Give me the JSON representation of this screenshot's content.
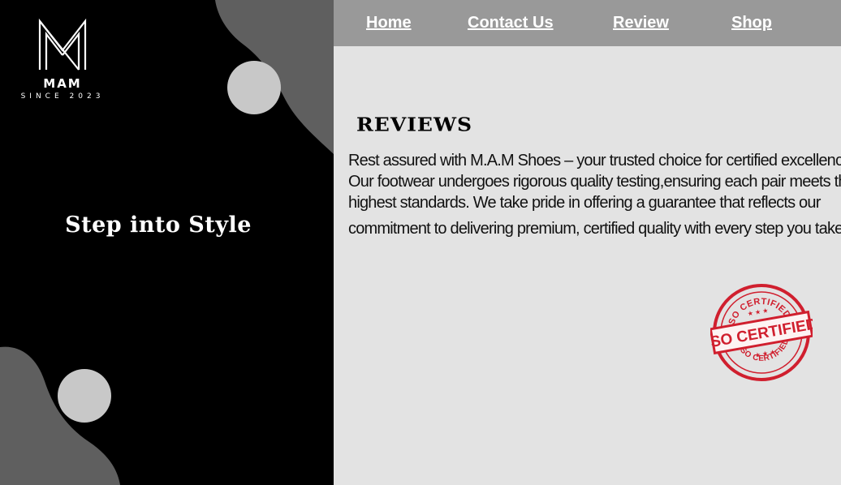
{
  "brand": {
    "name": "MAM",
    "since": "SINCE 2023",
    "tagline": "Step into Style"
  },
  "nav": {
    "items": [
      {
        "label": "Home"
      },
      {
        "label": "Contact Us"
      },
      {
        "label": "Review"
      },
      {
        "label": "Shop"
      }
    ]
  },
  "reviews": {
    "heading": "REVIEWS",
    "lines": [
      "Rest assured with M.A.M Shoes – your trusted choice for certified excellence.",
      "Our footwear undergoes rigorous quality testing,ensuring each pair meets the",
      "highest standards. We take pride in offering a guarantee that reflects our",
      "commitment to delivering premium, certified quality with every step you take."
    ]
  },
  "stamp": {
    "top_text": "ISO CERTIFIED",
    "center_text": "ISO CERTIFIED",
    "bottom_text": "ISO CERTIFIED",
    "color": "#d01f2e"
  },
  "colors": {
    "left_panel": "#000000",
    "shape_gray": "#5f5f5f",
    "circle_light": "#c8c8c8",
    "nav_bg": "#999999",
    "content_bg": "#e3e3e3"
  }
}
